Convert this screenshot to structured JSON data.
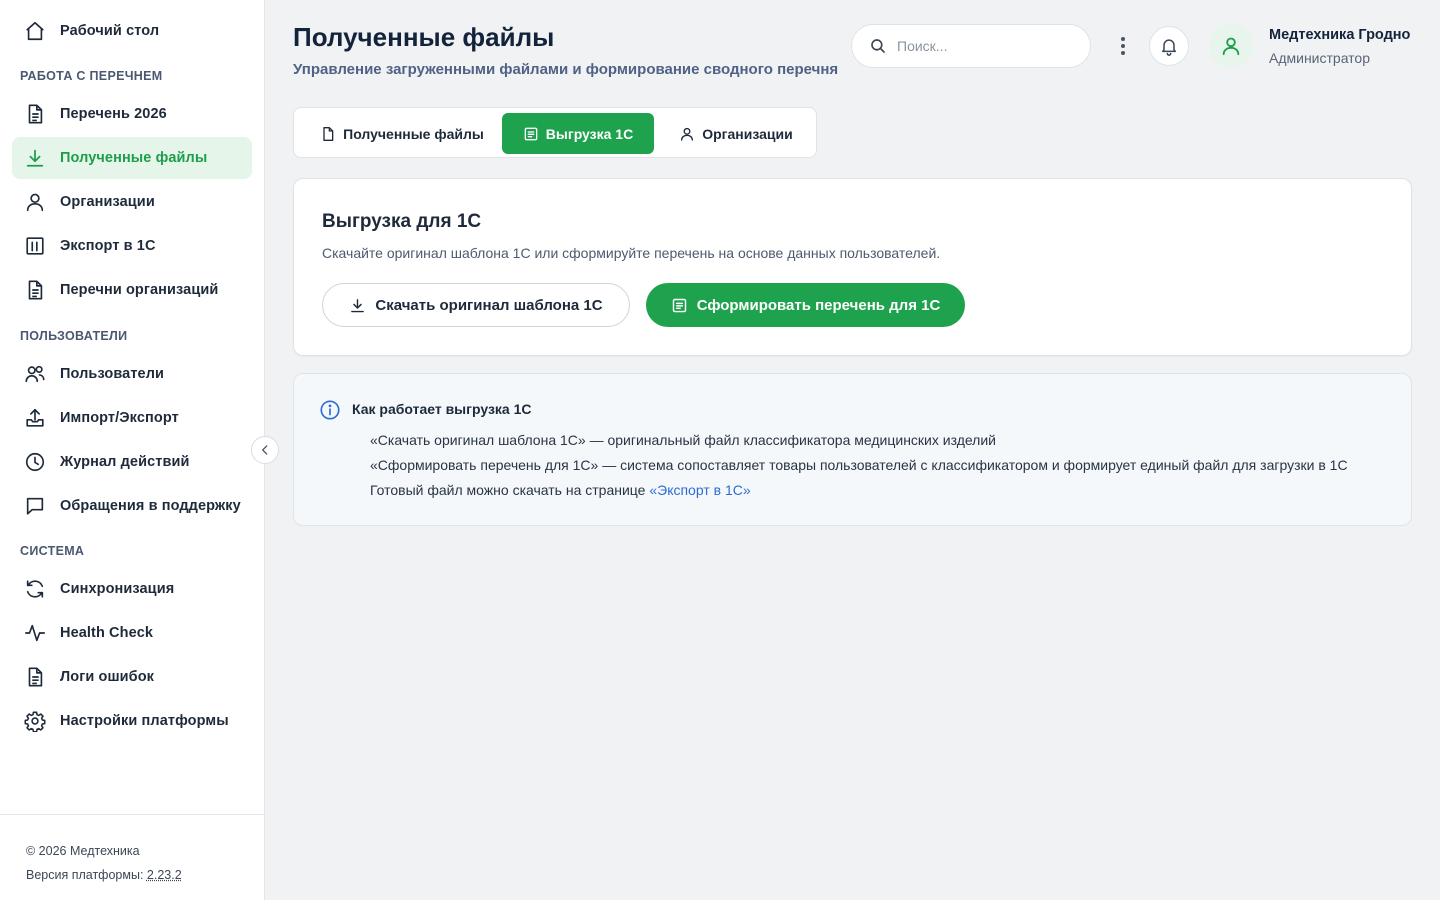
{
  "sidebar": {
    "top_item": {
      "label": "Рабочий стол",
      "icon": "home-icon"
    },
    "sections": [
      {
        "title": "РАБОТА С ПЕРЕЧНЕМ"
      },
      {
        "title": "ПОЛЬЗОВАТЕЛИ"
      },
      {
        "title": "СИСТЕМА"
      }
    ],
    "items": [
      {
        "label": "Перечень 2026",
        "icon": "document-icon"
      },
      {
        "label": "Полученные файлы",
        "icon": "download-icon",
        "active": true
      },
      {
        "label": "Организации",
        "icon": "user-icon"
      },
      {
        "label": "Экспорт в 1С",
        "icon": "chart-box-icon"
      },
      {
        "label": "Перечни организаций",
        "icon": "document-icon"
      },
      {
        "label": "Пользователи",
        "icon": "users-icon"
      },
      {
        "label": "Импорт/Экспорт",
        "icon": "upload-tray-icon"
      },
      {
        "label": "Журнал действий",
        "icon": "clock-icon"
      },
      {
        "label": "Обращения в поддержку",
        "icon": "chat-bubble-icon"
      },
      {
        "label": "Синхронизация",
        "icon": "sync-icon"
      },
      {
        "label": "Health Check",
        "icon": "pulse-icon"
      },
      {
        "label": "Логи ошибок",
        "icon": "document-icon"
      },
      {
        "label": "Настройки платформы",
        "icon": "gear-icon"
      }
    ],
    "footer": {
      "copyright": "© 2026 Медтехника",
      "version_label": "Версия платформы:",
      "version": "2.23.2"
    }
  },
  "header": {
    "title": "Полученные файлы",
    "subtitle": "Управление загруженными файлами и формирование сводного перечня",
    "search_placeholder": "Поиск...",
    "user_name": "Медтехника Гродно",
    "user_role": "Администратор"
  },
  "tabs": [
    {
      "label": "Полученные файлы",
      "icon": "file-icon"
    },
    {
      "label": "Выгрузка 1С",
      "icon": "list-doc-icon",
      "active": true
    },
    {
      "label": "Организации",
      "icon": "user-icon"
    }
  ],
  "export_card": {
    "title": "Выгрузка для 1С",
    "description": "Скачайте оригинал шаблона 1С или сформируйте перечень на основе данных пользователей.",
    "download_button": "Скачать оригинал шаблона 1С",
    "generate_button": "Сформировать перечень для 1С"
  },
  "info_card": {
    "title": "Как работает выгрузка 1С",
    "line1": "«Скачать оригинал шаблона 1С» — оригинальный файл классификатора медицинских изделий",
    "line2": "«Сформировать перечень для 1С» — система сопоставляет товары пользователей с классификатором и формирует единый файл для загрузки в 1С",
    "line3_text": "Готовый файл можно скачать на странице ",
    "line3_link": "«Экспорт в 1С»"
  },
  "colors": {
    "accent": "#1fa24d",
    "active_bg": "#e6f5ea",
    "link": "#2e6bd3",
    "background": "#f1f2f4"
  }
}
